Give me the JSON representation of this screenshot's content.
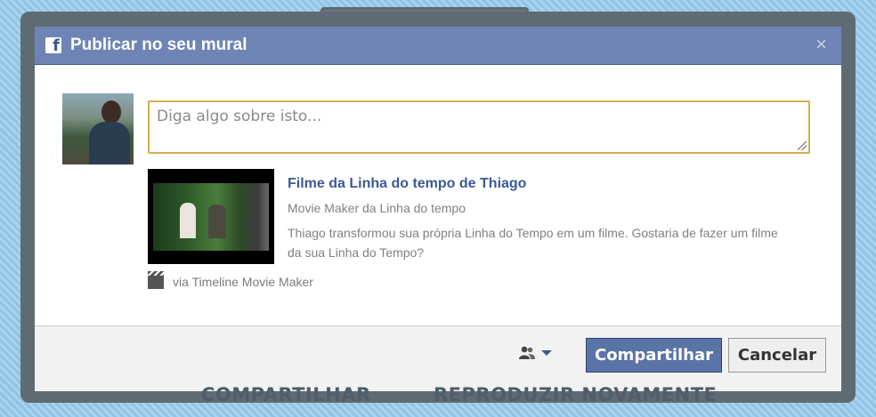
{
  "background": {
    "bottom_labels": [
      "COMPARTILHAR",
      "REPRODUZIR NOVAMENTE"
    ]
  },
  "dialog": {
    "logo_letter": "f",
    "title": "Publicar no seu mural",
    "close_glyph": "×"
  },
  "composer": {
    "placeholder": "Diga algo sobre isto..."
  },
  "attachment": {
    "title": "Filme da Linha do tempo de Thiago",
    "caption": "Movie Maker da Linha do tempo",
    "description": "Thiago transformou sua própria Linha do Tempo em um filme. Gostaria de fazer um filme da sua Linha do Tempo?",
    "via_text": "via Timeline Movie Maker"
  },
  "footer": {
    "audience_icon": "friends-icon",
    "share_label": "Compartilhar",
    "cancel_label": "Cancelar"
  },
  "colors": {
    "titlebar": "#6d84b4",
    "link": "#3b5998",
    "primary_button": "#5b74a8",
    "textarea_focus_border": "#d3b04e"
  }
}
